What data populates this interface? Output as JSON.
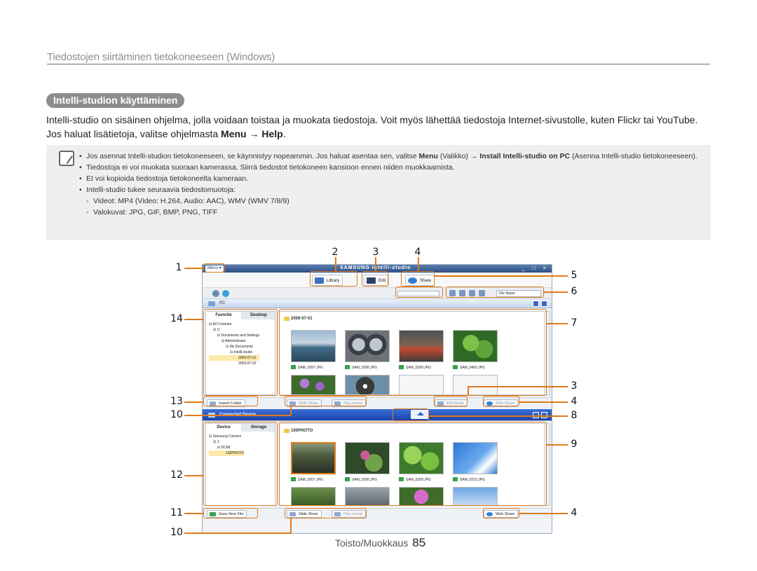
{
  "header": {
    "title": "Tiedostojen siirtäminen tietokoneeseen (Windows)"
  },
  "section": {
    "title": "Intelli-studion käyttäminen",
    "intro_prefix": "Intelli-studio on sisäinen ohjelma, jolla voidaan toistaa ja muokata tiedostoja. Voit myös lähettää tiedostoja Internet-sivustolle, kuten Flickr tai YouTube. Jos haluat lisätietoja, valitse ohjelmasta ",
    "intro_menu": "Menu",
    "intro_arrow": " → ",
    "intro_help": "Help",
    "intro_end": "."
  },
  "notes": {
    "n1_a": "Jos asennat Intelli-studion tietokoneeseen, se käynnistyy nopeammin. Jos haluat asentaa sen, valitse ",
    "n1_menu": "Menu",
    "n1_b": " (Valikko) → ",
    "n1_install": "Install Intelli-studio on PC",
    "n1_c": " (Asenna Intelli-studio tietokoneeseen).",
    "n2": "Tiedostoja ei voi muokata suoraan kamerassa. Siirrä tiedostot tietokoneen kansioon ennen niiden muokkaamista.",
    "n3": "Et voi kopioida tiedostoja tietokoneelta kameraan.",
    "n4": "Intelli-studio tukee seuraavia tiedostomuotoja:",
    "s1": "Videot: MP4 (Video: H.264, Audio: AAC), WMV (WMV 7/8/9)",
    "s2": "Valokuvat: JPG, GIF, BMP, PNG, TIFF"
  },
  "app": {
    "menu": "Menu ▾",
    "brand": "SAMSUNG Intelli-studio",
    "window_controls": "_ □ ×",
    "toolbar": {
      "library": "Library",
      "edit": "Edit",
      "share": "Share"
    },
    "sort": "File Name",
    "pc_pane": "PC",
    "device_pane": "Connected Device",
    "pc_tabs": [
      "Favorite",
      "Desktop"
    ],
    "pc_tree": [
      "⊟ All Contents",
      "⊟ C:",
      "⊟ Documents and Settings",
      "⊟ Administrator",
      "⊟ My Documents",
      "⊟ Intelli-studio",
      "2009-07-01",
      "2009-07-02"
    ],
    "pc_folder": "2009-07-01",
    "pc_files": [
      "SAM_0397.JPG",
      "SAM_0398.JPG",
      "SAM_0399.JPG",
      "SAM_0400.JPG"
    ],
    "device_tabs": [
      "Device",
      "Storage"
    ],
    "device_tree": [
      "⊟ Samsung Camera",
      "⊟ J:",
      "⊟ DCIM",
      "100PHOTO"
    ],
    "device_folder": "100PHOTO",
    "device_files": [
      "SAM_0207.JPG",
      "SAM_0208.JPG",
      "SAM_0209.JPG",
      "SAM_0210.JPG"
    ],
    "pc_actions": {
      "import": "Import Folder",
      "slide": "Slide Show",
      "play": "Play movie",
      "edit": "Edit Mode",
      "web": "Web Share"
    },
    "device_actions": {
      "save": "Save New File",
      "slide": "Slide Show",
      "play": "Play movie",
      "web": "Web Share"
    }
  },
  "callouts": [
    "1",
    "2",
    "3",
    "4",
    "5",
    "6",
    "7",
    "3",
    "4",
    "8",
    "9",
    "4",
    "14",
    "13",
    "10",
    "12",
    "11",
    "10"
  ],
  "footer": {
    "label": "Toisto/Muokkaus",
    "page": "85"
  },
  "colors": {
    "callout": "#e07a1a",
    "pill": "#8d8d8d"
  }
}
